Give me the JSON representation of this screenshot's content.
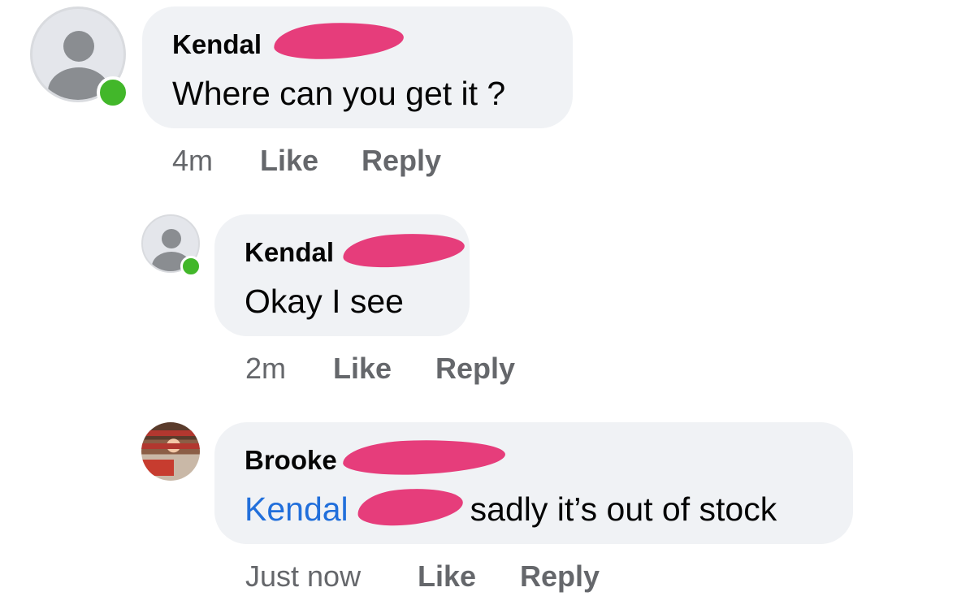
{
  "comments": [
    {
      "author": "Kendal",
      "text": "Where can you get it ?",
      "time": "4m",
      "like_label": "Like",
      "reply_label": "Reply"
    },
    {
      "author": "Kendal",
      "text": "Okay I see",
      "time": "2m",
      "like_label": "Like",
      "reply_label": "Reply"
    },
    {
      "author": "Brooke",
      "mention": "Kendal",
      "text": "sadly it’s out of stock",
      "time": "Just now",
      "like_label": "Like",
      "reply_label": "Reply"
    }
  ],
  "colors": {
    "bubble": "#f0f2f5",
    "online": "#42b72a",
    "mention": "#216fdb",
    "meta": "#65676b",
    "redaction": "#e63d7b"
  }
}
